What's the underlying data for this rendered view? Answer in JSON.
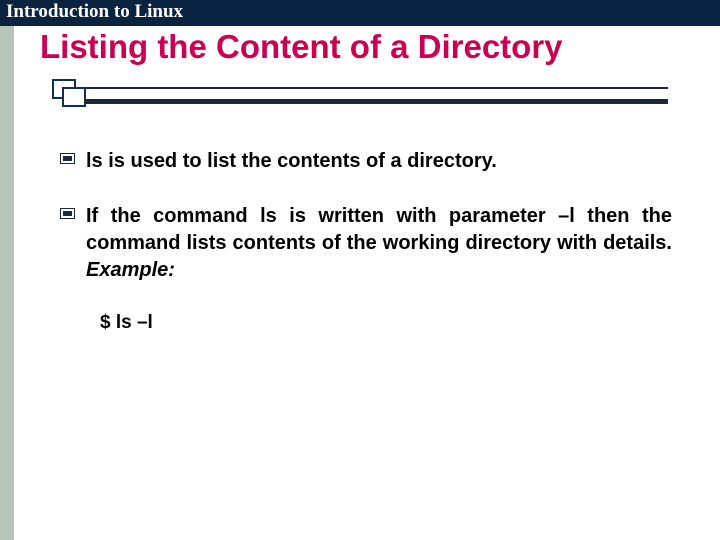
{
  "header": {
    "course": "Introduction to Linux"
  },
  "title": "Listing the Content of a Directory",
  "bullets": [
    {
      "text": "ls is used to list the contents of a directory."
    },
    {
      "text": "If the command ls is written with parameter –l then the command lists contents of the working directory with details. ",
      "example_label": "Example:"
    }
  ],
  "example_command": "$ ls –l"
}
